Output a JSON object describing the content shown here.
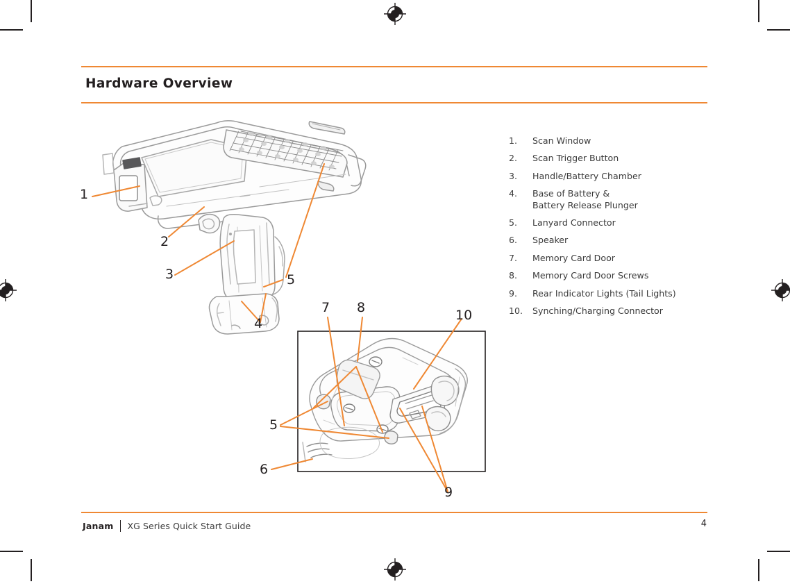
{
  "document": {
    "title": "Hardware Overview",
    "footer": {
      "brand": "Janam",
      "doc_title": "XG Series Quick Start Guide",
      "page_number": "4"
    }
  },
  "colors": {
    "accent_orange": "#ef8833",
    "text_dark": "#231f20",
    "text_body": "#3a3a3a",
    "line_art": "#8a8a8a"
  },
  "legend": {
    "items": [
      {
        "num": "1.",
        "label": "Scan Window"
      },
      {
        "num": "2.",
        "label": "Scan Trigger Button"
      },
      {
        "num": "3.",
        "label": "Handle/Battery Chamber"
      },
      {
        "num": "4.",
        "label": "Base of Battery &\nBattery Release Plunger"
      },
      {
        "num": "5.",
        "label": "Lanyard Connector"
      },
      {
        "num": "6.",
        "label": "Speaker"
      },
      {
        "num": "7.",
        "label": "Memory Card Door"
      },
      {
        "num": "8.",
        "label": "Memory Card Door Screws"
      },
      {
        "num": "9.",
        "label": "Rear Indicator Lights (Tail Lights)"
      },
      {
        "num": "10.",
        "label": "Synching/Charging Connector"
      }
    ]
  },
  "figures": {
    "main": {
      "name": "handheld-scanner-gun-line-drawing",
      "callouts": [
        {
          "id": "1",
          "label": "1"
        },
        {
          "id": "2",
          "label": "2"
        },
        {
          "id": "3",
          "label": "3"
        },
        {
          "id": "4",
          "label": "4"
        },
        {
          "id": "5",
          "label": "5"
        }
      ]
    },
    "inset": {
      "name": "device-base-detail-line-drawing",
      "callouts": [
        {
          "id": "5",
          "label": "5"
        },
        {
          "id": "6",
          "label": "6"
        },
        {
          "id": "7",
          "label": "7"
        },
        {
          "id": "8",
          "label": "8"
        },
        {
          "id": "9",
          "label": "9"
        },
        {
          "id": "10",
          "label": "10"
        }
      ]
    }
  }
}
